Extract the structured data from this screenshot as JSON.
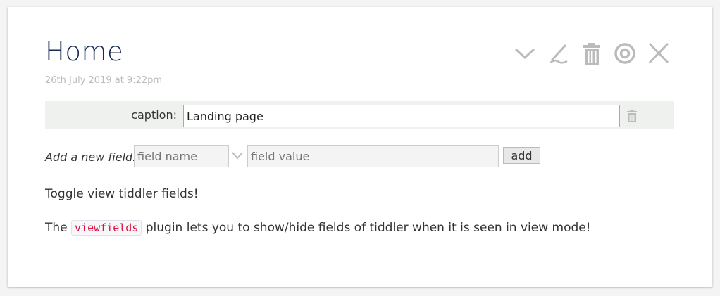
{
  "tiddler": {
    "title": "Home",
    "subtitle": "26th July 2019 at 9:22pm"
  },
  "controls": [
    {
      "name": "more-actions",
      "icon": "chevron-down-icon"
    },
    {
      "name": "edit",
      "icon": "pencil-icon"
    },
    {
      "name": "delete",
      "icon": "trash-icon"
    },
    {
      "name": "permalink",
      "icon": "target-icon"
    },
    {
      "name": "close",
      "icon": "close-icon"
    }
  ],
  "fields": [
    {
      "label": "caption:",
      "value": "Landing page"
    }
  ],
  "add_field": {
    "label": "Add a new field:",
    "name_placeholder": "field name",
    "value_placeholder": "field value",
    "button_label": "add"
  },
  "body": {
    "p1": "Toggle view tiddler fields!",
    "p2_before": "The ",
    "p2_code": "viewfields",
    "p2_after": " plugin lets you to show/hide fields of tiddler when it is seen in view mode!"
  },
  "colors": {
    "title": "#182955",
    "icon": "#bbbbbb",
    "code": "#dd1144",
    "field_row_bg": "#eef1ee"
  }
}
